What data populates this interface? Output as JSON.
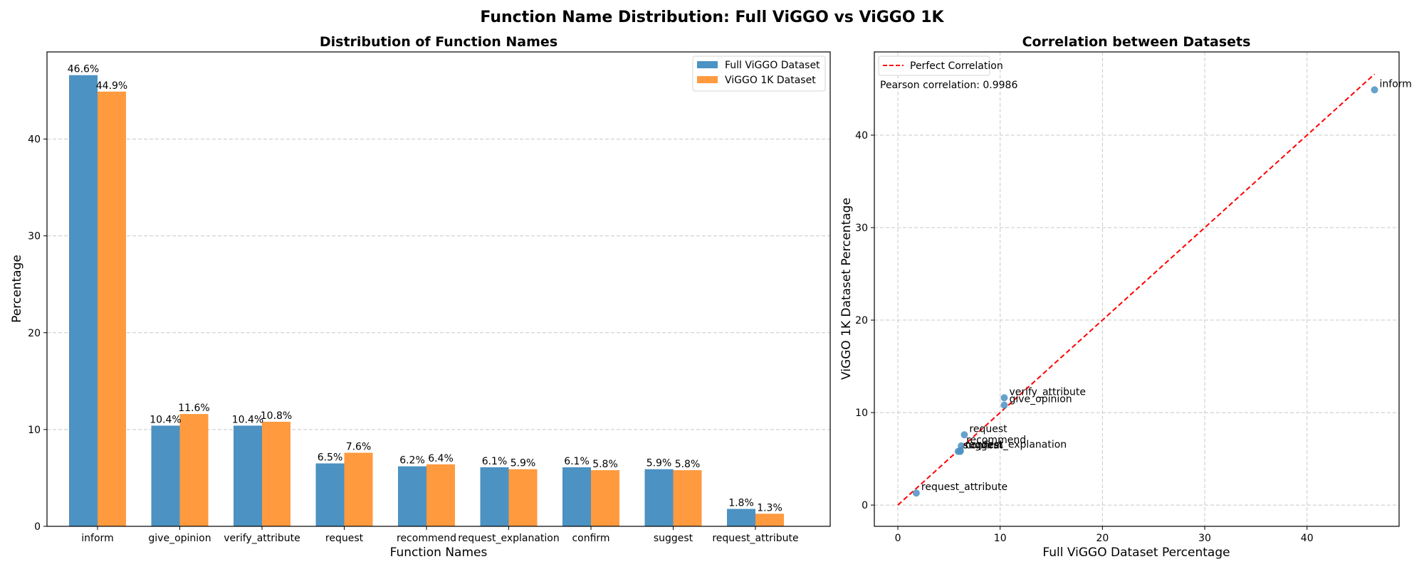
{
  "figure": {
    "suptitle": "Function Name Distribution: Full ViGGO vs ViGGO 1K"
  },
  "colors": {
    "full": "#4c92c3",
    "onek": "#ff9a3f",
    "perfect_line": "#ff0000",
    "grid": "#c8c8c8",
    "scatter": "#4c92c3"
  },
  "chart_data": [
    {
      "type": "bar",
      "title": "Distribution of Function Names",
      "xlabel": "Function Names",
      "ylabel": "Percentage",
      "ylim": [
        0,
        49
      ],
      "yticks": [
        0,
        10,
        20,
        30,
        40
      ],
      "grid": "y-dashed",
      "legend_position": "top-right",
      "categories": [
        "inform",
        "give_opinion",
        "verify_attribute",
        "request",
        "recommend",
        "request_explanation",
        "confirm",
        "suggest",
        "request_attribute"
      ],
      "series": [
        {
          "name": "Full ViGGO Dataset",
          "values": [
            46.6,
            10.4,
            10.4,
            6.5,
            6.2,
            6.1,
            6.1,
            5.9,
            1.8
          ],
          "labels": [
            "46.6%",
            "10.4%",
            "10.4%",
            "6.5%",
            "6.2%",
            "6.1%",
            "6.1%",
            "5.9%",
            "1.8%"
          ]
        },
        {
          "name": "ViGGO 1K Dataset",
          "values": [
            44.9,
            11.6,
            10.8,
            7.6,
            6.4,
            5.9,
            5.8,
            5.8,
            1.3
          ],
          "labels": [
            "44.9%",
            "11.6%",
            "10.8%",
            "7.6%",
            "6.4%",
            "5.9%",
            "5.8%",
            "5.8%",
            "1.3%"
          ]
        }
      ]
    },
    {
      "type": "scatter",
      "title": "Correlation between Datasets",
      "xlabel": "Full ViGGO Dataset Percentage",
      "ylabel": "ViGGO 1K Dataset Percentage",
      "xlim": [
        -2.3,
        49
      ],
      "ylim": [
        -2.3,
        49
      ],
      "xticks": [
        0,
        10,
        20,
        30,
        40
      ],
      "yticks": [
        0,
        10,
        20,
        30,
        40
      ],
      "grid": "both-dashed",
      "legend_position": "top-left",
      "legend": [
        "Perfect Correlation"
      ],
      "annotation": "Pearson correlation: 0.9986",
      "perfect_line": {
        "x": [
          0,
          46.6
        ],
        "y": [
          0,
          46.6
        ]
      },
      "points": [
        {
          "label": "inform",
          "x": 46.6,
          "y": 44.9
        },
        {
          "label": "give_opinion",
          "x": 10.4,
          "y": 10.8
        },
        {
          "label": "verify_attribute",
          "x": 10.4,
          "y": 11.6
        },
        {
          "label": "request",
          "x": 6.5,
          "y": 7.6
        },
        {
          "label": "recommend",
          "x": 6.2,
          "y": 6.4
        },
        {
          "label": "request_explanation",
          "x": 6.1,
          "y": 5.9
        },
        {
          "label": "confirm",
          "x": 6.1,
          "y": 5.8
        },
        {
          "label": "suggest",
          "x": 5.9,
          "y": 5.8
        },
        {
          "label": "request_attribute",
          "x": 1.8,
          "y": 1.3
        }
      ]
    }
  ]
}
